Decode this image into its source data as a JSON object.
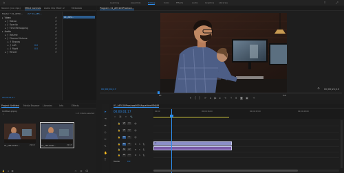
{
  "workspaces": [
    {
      "label": "Learning",
      "active": false
    },
    {
      "label": "Assembly",
      "active": false
    },
    {
      "label": "Editing",
      "active": true
    },
    {
      "label": "Color",
      "active": false
    },
    {
      "label": "Effects",
      "active": false
    },
    {
      "label": "Audio",
      "active": false
    },
    {
      "label": "Graphics",
      "active": false
    },
    {
      "label": "Libraries",
      "active": false
    }
  ],
  "source_panel": {
    "tabs": [
      {
        "label": "Source: (no clips)",
        "active": false
      },
      {
        "label": "Effect Controls",
        "active": true
      },
      {
        "label": "Audio Clip Mixer: 2",
        "active": false
      },
      {
        "label": "Metadata",
        "active": false
      }
    ],
    "master_label": "Master * 01_AE50…",
    "clip_label": "2) * 01_AE5…",
    "clip_chip": "01_AE5…",
    "sections": [
      {
        "label": "Video",
        "indent": 0
      },
      {
        "label": "Motion",
        "indent": 1
      },
      {
        "label": "Opacity",
        "indent": 1
      },
      {
        "label": "Time Remapping",
        "indent": 1
      },
      {
        "label": "Audio",
        "indent": 0
      },
      {
        "label": "Volume",
        "indent": 1
      },
      {
        "label": "Channel Volume",
        "indent": 1
      },
      {
        "label": "Bypass",
        "indent": 2
      },
      {
        "label": "Left",
        "indent": 2,
        "value": "0.0"
      },
      {
        "label": "Right",
        "indent": 2,
        "value": "0.0"
      },
      {
        "label": "Panner",
        "indent": 1
      }
    ],
    "timecode": "00;00;01;17"
  },
  "program_monitor": {
    "title": "Program: 01_AE5100Proshow…",
    "timecode_left": "00;00;01;17",
    "timecode_right": "00;00;21;13",
    "fit_label": "Fit",
    "resolution": "Full"
  },
  "project_panel": {
    "tabs": [
      {
        "label": "Project: Untitled",
        "active": true
      },
      {
        "label": "Media Browser",
        "active": false
      },
      {
        "label": "Libraries",
        "active": false
      },
      {
        "label": "Info",
        "active": false
      },
      {
        "label": "Effects",
        "active": false
      }
    ],
    "path": "Untitled.prproj",
    "items_count": "1 of 2 items selected",
    "clips": [
      {
        "name": "01_AE5100Pro…",
        "duration": "21;13",
        "selected": false
      },
      {
        "name": "01_AE5100Pr…",
        "duration": "21;13",
        "selected": true
      }
    ]
  },
  "timeline": {
    "tab_title": "01_AE5100Proshow0000AquatickelSMjUR",
    "timecode": "00;00;01;17",
    "ruler": [
      "00;00",
      "00;00;16;00",
      "00;00;32;00",
      "00;00;48;00"
    ],
    "tracks": [
      {
        "label": "V3",
        "type": "video"
      },
      {
        "label": "V2",
        "type": "video"
      },
      {
        "label": "V1",
        "type": "video"
      },
      {
        "label": "A1",
        "type": "audio"
      },
      {
        "label": "A2",
        "type": "audio"
      },
      {
        "label": "A3",
        "type": "audio"
      }
    ],
    "master_label": "Master",
    "master_value": "0.0"
  },
  "colors": {
    "accent": "#2d8ceb",
    "video_clip": "#8c8fc8",
    "audio_clip": "#5a9a6a",
    "playhead": "#2d8ceb"
  }
}
